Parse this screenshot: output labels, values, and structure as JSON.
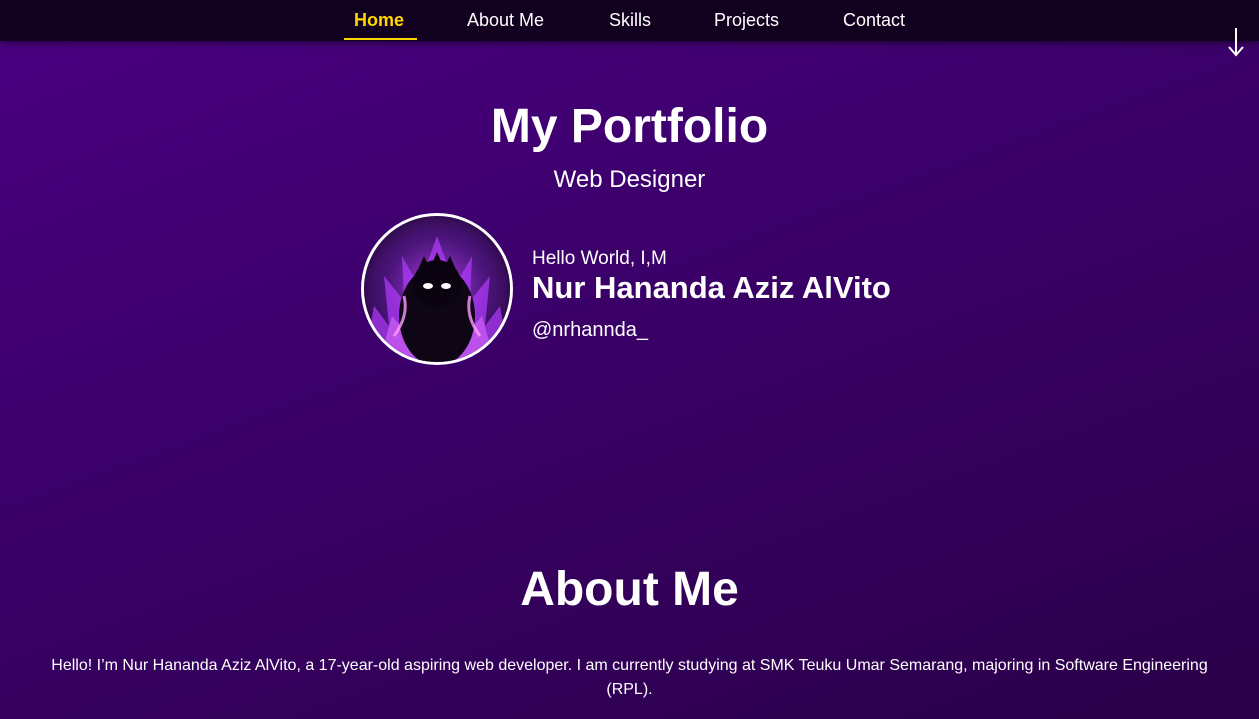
{
  "nav": {
    "items": [
      {
        "label": "Home",
        "active": true
      },
      {
        "label": "About Me",
        "active": false
      },
      {
        "label": "Skills",
        "active": false
      },
      {
        "label": "Projects",
        "active": false
      },
      {
        "label": "Contact",
        "active": false
      }
    ],
    "scroll_icon": "arrow-down-icon"
  },
  "hero": {
    "title": "My Portfolio",
    "subtitle": "Web Designer"
  },
  "profile": {
    "greeting": "Hello World, I,M",
    "name": "Nur Hananda Aziz AlVito",
    "handle": "@nrhannda_",
    "avatar_icon": "avatar-illustration"
  },
  "about": {
    "title": "About Me",
    "text": "Hello! I’m Nur Hananda Aziz AlVito, a 17-year-old aspiring web developer. I am currently studying at SMK Teuku Umar Semarang, majoring in Software Engineering (RPL)."
  },
  "colors": {
    "background_start": "#4b0082",
    "background_end": "#2a0048",
    "navbar": "#12001f",
    "accent": "#ffd700",
    "text": "#ffffff"
  }
}
